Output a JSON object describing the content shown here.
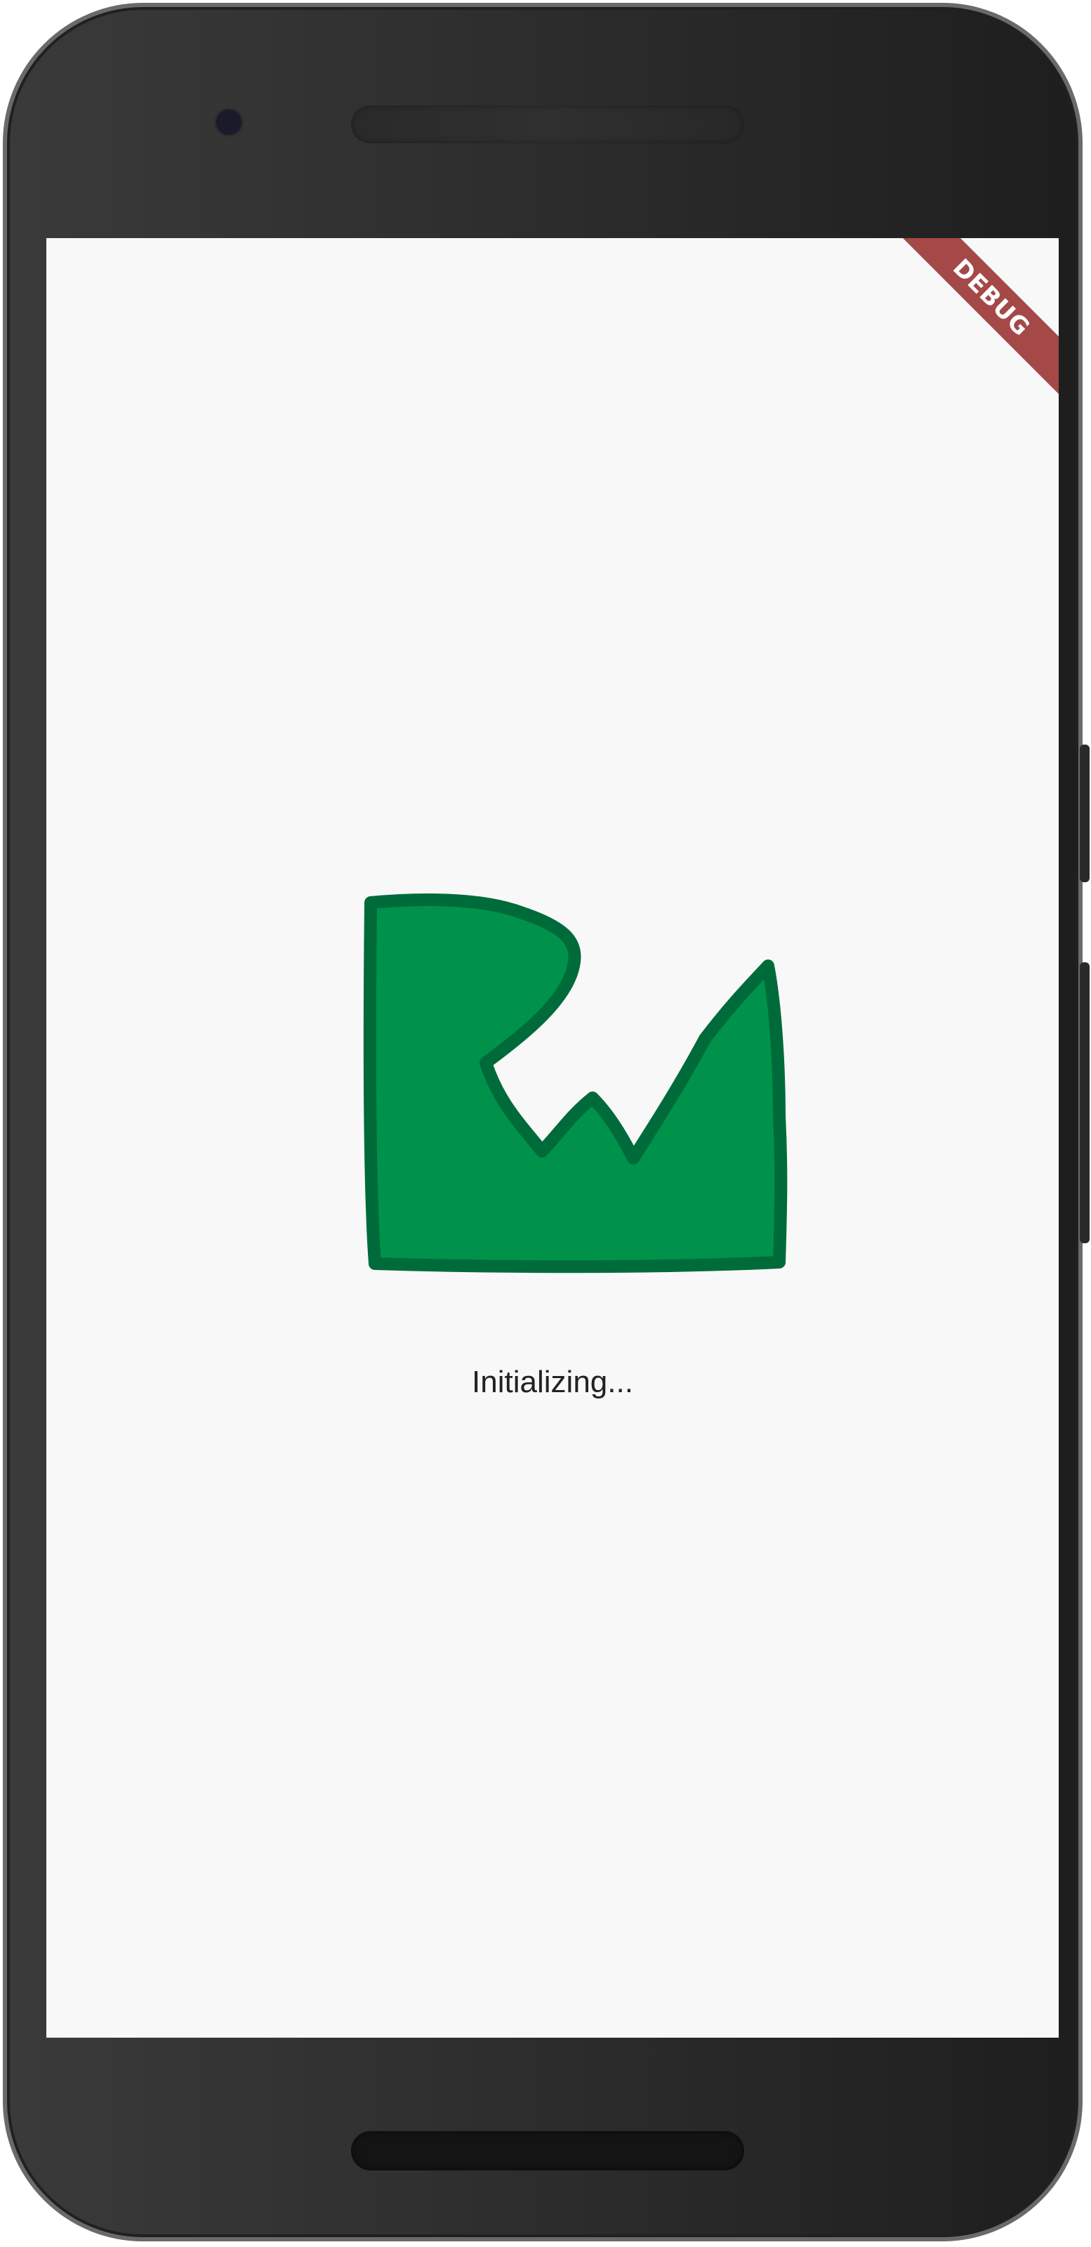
{
  "banner": {
    "label": "DEBUG",
    "color": "#a54848"
  },
  "splash": {
    "status_text": "Initializing...",
    "logo_icon": "grass-logo-icon",
    "logo_fill": "#00924a",
    "logo_stroke": "#006b3a"
  },
  "device": {
    "camera_icon": "front-camera-icon",
    "speaker_icon": "speaker-grille-icon"
  }
}
